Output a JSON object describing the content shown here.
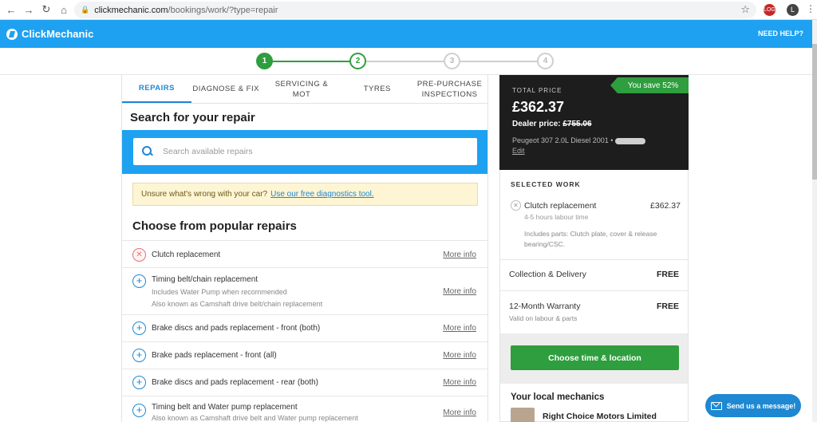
{
  "browser": {
    "url_host": "clickmechanic.com",
    "url_path": "/bookings/work/?type=repair",
    "ext1_label": "LOG",
    "ext2_label": "L"
  },
  "header": {
    "logo_text": "ClickMechanic",
    "help_label": "NEED HELP?"
  },
  "stepper": {
    "steps": [
      "1",
      "2",
      "3",
      "4"
    ],
    "current": 2,
    "colors": {
      "done": "#2e9e3e",
      "todo": "#cfcfcf"
    }
  },
  "tabs": [
    {
      "label": "REPAIRS"
    },
    {
      "label": "DIAGNOSE & FIX"
    },
    {
      "label": "SERVICING & MOT"
    },
    {
      "label": "TYRES"
    },
    {
      "label": "PRE-PURCHASE INSPECTIONS"
    }
  ],
  "search": {
    "title": "Search for your repair",
    "placeholder": "Search available repairs"
  },
  "notice": {
    "text": "Unsure what's wrong with your car?",
    "link": "Use our free diagnostics tool."
  },
  "popular": {
    "title": "Choose from popular repairs",
    "more_label": "More info",
    "items": [
      {
        "name": "Clutch replacement",
        "selected": true
      },
      {
        "name": "Timing belt/chain replacement",
        "sub1": "Includes Water Pump when recommended",
        "sub2": "Also known as Camshaft drive belt/chain replacement"
      },
      {
        "name": "Brake discs and pads replacement - front (both)"
      },
      {
        "name": "Brake pads replacement - front (all)"
      },
      {
        "name": "Brake discs and pads replacement - rear (both)"
      },
      {
        "name": "Timing belt and Water pump replacement",
        "sub1": "Also known as Camshaft drive belt and Water pump replacement"
      }
    ]
  },
  "price": {
    "save_label": "You save 52%",
    "total_label": "TOTAL PRICE",
    "total": "£362.37",
    "dealer_label": "Dealer price:",
    "dealer_price": "£755.06",
    "vehicle": "Peugeot 307 2.0L Diesel 2001 •",
    "edit_label": "Edit"
  },
  "selected": {
    "title": "SELECTED WORK",
    "item_name": "Clutch replacement",
    "item_price": "£362.37",
    "item_hours": "4-5 hours labour time",
    "item_parts": "Includes parts: Clutch plate, cover & release bearing/CSC.",
    "collection_label": "Collection & Delivery",
    "collection_value": "FREE",
    "warranty_label": "12-Month Warranty",
    "warranty_value": "FREE",
    "warranty_sub": "Valid on labour & parts",
    "cta_label": "Choose time & location",
    "local_title": "Your local mechanics",
    "garage_name": "Right Choice Motors Limited"
  },
  "chat": {
    "label": "Send us a message!"
  }
}
